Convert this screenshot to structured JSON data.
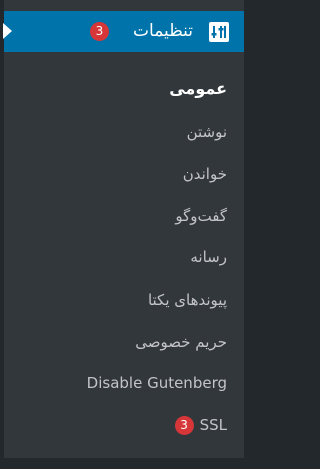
{
  "menu": {
    "header": {
      "label": "تنظیمات",
      "badge": "3",
      "icon": "settings-sliders-icon"
    },
    "items": [
      {
        "label": "عمومی",
        "current": true
      },
      {
        "label": "نوشتن"
      },
      {
        "label": "خواندن"
      },
      {
        "label": "گفت‌وگو"
      },
      {
        "label": "رسانه"
      },
      {
        "label": "پیوندهای یکتا"
      },
      {
        "label": "حریم خصوصی"
      },
      {
        "label": "Disable Gutenberg"
      },
      {
        "label": "SSL",
        "badge": "3"
      }
    ]
  },
  "colors": {
    "header_bg": "#0073aa",
    "menu_bg": "#32373c",
    "badge_bg": "#d63638",
    "text_current": "#ffffff",
    "text_default": "#c3c4c7"
  }
}
